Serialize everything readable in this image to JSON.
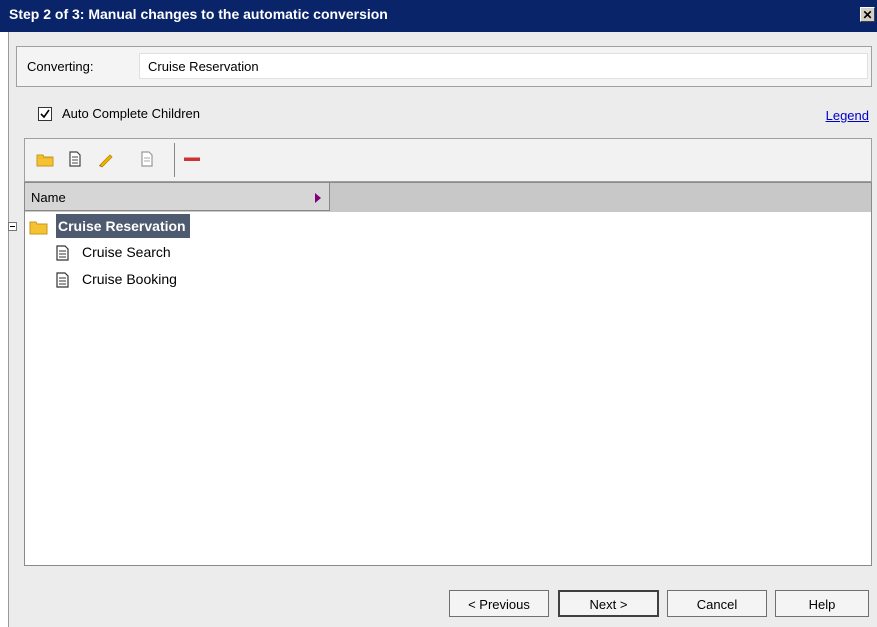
{
  "window": {
    "title": "Step 2 of 3: Manual changes to the automatic conversion",
    "close_glyph": "✕"
  },
  "converting": {
    "label": "Converting:",
    "value": "Cruise Reservation"
  },
  "options": {
    "auto_complete_label": "Auto Complete Children",
    "auto_complete_checked": true,
    "legend_link": "Legend"
  },
  "toolbar": {
    "icons": [
      "new-folder-icon",
      "new-requirement-icon",
      "rename-icon",
      "properties-icon",
      "delete-icon"
    ]
  },
  "grid": {
    "column_header": "Name",
    "root": {
      "label": "Cruise Reservation",
      "expanded": true,
      "icon": "folder-icon"
    },
    "children": [
      {
        "label": "Cruise Search",
        "icon": "document-icon"
      },
      {
        "label": "Cruise Booking",
        "icon": "document-icon"
      }
    ]
  },
  "buttons": {
    "previous": "< Previous",
    "next": "Next >",
    "cancel": "Cancel",
    "help": "Help"
  },
  "colors": {
    "title_bar": "#0a246a",
    "selection": "#4d5a6f",
    "link": "#0000cc",
    "delete": "#cc3333"
  }
}
